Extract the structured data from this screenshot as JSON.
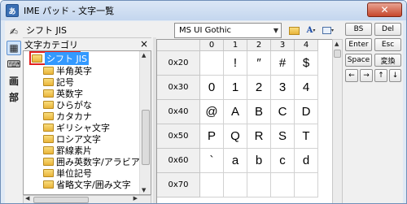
{
  "window": {
    "title": "IME パッド - 文字一覧",
    "app_icon": "ime-pad-icon",
    "close_glyph": "✕"
  },
  "left_tools": [
    {
      "name": "handwriting-icon",
      "glyph": "✍"
    },
    {
      "name": "character-list-icon",
      "glyph": "▦",
      "active": true
    },
    {
      "name": "soft-keyboard-icon",
      "glyph": "⌨"
    },
    {
      "name": "stroke-count-icon",
      "glyph": "画"
    },
    {
      "name": "radical-icon",
      "glyph": "部"
    }
  ],
  "category": {
    "current_label": "シフト JIS",
    "panel_title": "文字カテゴリ",
    "close_glyph": "×",
    "items": [
      {
        "label": "シフト JIS",
        "selected": true,
        "level": 0
      },
      {
        "label": "半角英字",
        "level": 1
      },
      {
        "label": "記号",
        "level": 1
      },
      {
        "label": "英数字",
        "level": 1
      },
      {
        "label": "ひらがな",
        "level": 1
      },
      {
        "label": "カタカナ",
        "level": 1
      },
      {
        "label": "ギリシャ文字",
        "level": 1
      },
      {
        "label": "ロシア文字",
        "level": 1
      },
      {
        "label": "罫線素片",
        "level": 1
      },
      {
        "label": "囲み英数字/アラビア",
        "level": 1
      },
      {
        "label": "単位記号",
        "level": 1
      },
      {
        "label": "省略文字/囲み文字",
        "level": 1
      }
    ]
  },
  "font": {
    "selected": "MS UI Gothic"
  },
  "grid": {
    "columns": [
      "0",
      "1",
      "2",
      "3",
      "4"
    ],
    "rows": [
      {
        "header": "0x20",
        "cells": [
          "",
          "!",
          "″",
          "#",
          "$"
        ]
      },
      {
        "header": "0x30",
        "cells": [
          "0",
          "1",
          "2",
          "3",
          "4"
        ]
      },
      {
        "header": "0x40",
        "cells": [
          "@",
          "A",
          "B",
          "C",
          "D"
        ]
      },
      {
        "header": "0x50",
        "cells": [
          "P",
          "Q",
          "R",
          "S",
          "T"
        ]
      },
      {
        "header": "0x60",
        "cells": [
          "`",
          "a",
          "b",
          "c",
          "d"
        ]
      },
      {
        "header": "0x70",
        "cells": [
          "",
          "",
          "",
          "",
          ""
        ]
      }
    ]
  },
  "keypad": {
    "bs": "BS",
    "del": "Del",
    "enter": "Enter",
    "esc": "Esc",
    "space": "Space",
    "convert": "変換",
    "left": "←",
    "right": "→",
    "up": "↑",
    "down": "↓"
  }
}
